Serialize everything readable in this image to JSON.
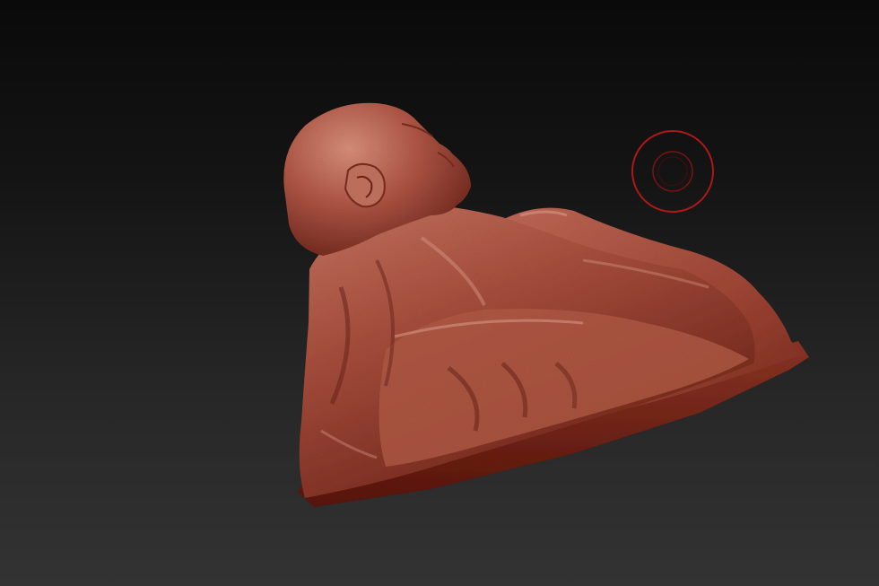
{
  "viewport": {
    "background_top": "#0a0a0a",
    "background_bottom": "#333333"
  },
  "model": {
    "material_color": "#a84b3c",
    "highlight_color": "#d98a76",
    "shadow_color": "#5a1e16"
  },
  "brush_cursor": {
    "icon": "brush-cursor-icon",
    "ring_color": "#b01818"
  }
}
